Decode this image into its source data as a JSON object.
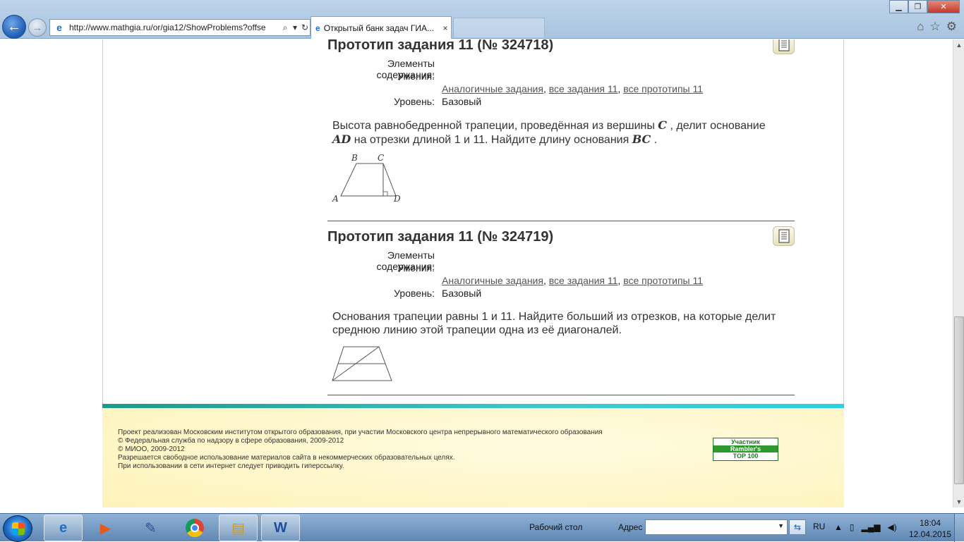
{
  "browser": {
    "url": "http://www.mathgia.ru/or/gia12/ShowProblems?offse",
    "active_tab_title": "Открытый банк задач ГИА...",
    "tab_close": "×",
    "back": "←",
    "forward": "→",
    "minimize": "▁",
    "restore": "❐",
    "close": "✕"
  },
  "tasks": [
    {
      "title": "Прототип задания 11 (№ 324718)",
      "elements_label": "Элементы содержания:",
      "skills_label": "Умения:",
      "links": [
        "Аналогичные задания",
        "все задания 11",
        "все прототипы 11"
      ],
      "level_label": "Уровень:",
      "level_value": "Базовый",
      "text_part1": "Высота равнобедренной трапеции, проведённая из вершины ",
      "var_c": "C",
      "text_part2": " , делит основание ",
      "var_ad": "AD",
      "text_part3": "  на отрезки длиной 1 и 11. Найдите длину основания ",
      "var_bc": "BC",
      "text_part4": " .",
      "fig_labels": {
        "A": "A",
        "B": "B",
        "C": "C",
        "D": "D"
      }
    },
    {
      "title": "Прототип задания 11 (№ 324719)",
      "elements_label": "Элементы содержания:",
      "skills_label": "Умения:",
      "links": [
        "Аналогичные задания",
        "все задания 11",
        "все прототипы 11"
      ],
      "level_label": "Уровень:",
      "level_value": "Базовый",
      "text": "Основания трапеции равны 1 и 11. Найдите больший из отрезков, на которые делит среднюю линию этой трапеции одна из её диагоналей."
    }
  ],
  "footer": {
    "lines": [
      "Проект реализован Московским институтом открытого образования, при участии Московского центра непрерывного математического образования",
      "© Федеральная служба по надзору в сфере образования, 2009-2012",
      "© МИОО, 2009-2012",
      "Разрешается свободное использование материалов сайта в некоммерческих образовательных целях.",
      "При использовании в сети интернет следует приводить гиперссылку."
    ],
    "rambler": [
      "Участник",
      "Rambler's",
      "TOP 100"
    ]
  },
  "taskbar": {
    "desktop_label": "Рабочий стол",
    "address_label": "Адрес",
    "address_value": "",
    "lang": "RU",
    "time": "18:04",
    "date": "12.04.2015"
  },
  "colors": {
    "accent_teal": "#3ec9c9",
    "footer_bg": "#fdf3b9",
    "rambler_green": "#2d9a2d"
  }
}
